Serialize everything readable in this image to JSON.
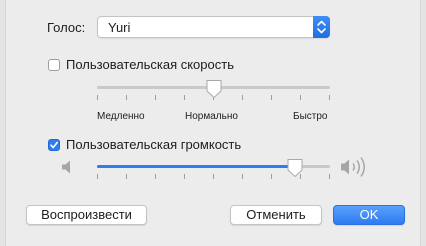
{
  "voice": {
    "label": "Голос:",
    "value": "Yuri"
  },
  "rate": {
    "checkbox_label": "Пользовательская скорость",
    "checked": false,
    "level": 0.5,
    "labels": {
      "slow": "Медленно",
      "normal": "Нормально",
      "fast": "Быстро"
    }
  },
  "volume": {
    "checkbox_label": "Пользовательская громкость",
    "checked": true,
    "level": 0.85
  },
  "buttons": {
    "play": "Воспроизвести",
    "cancel": "Отменить",
    "ok": "OK"
  },
  "icons": {
    "stepper": "up-down-chevron-icon",
    "checkmark": "checkmark-icon",
    "volume_low": "speaker-low-icon",
    "volume_high": "speaker-high-icon"
  },
  "colors": {
    "accent": "#2f7ef0"
  }
}
